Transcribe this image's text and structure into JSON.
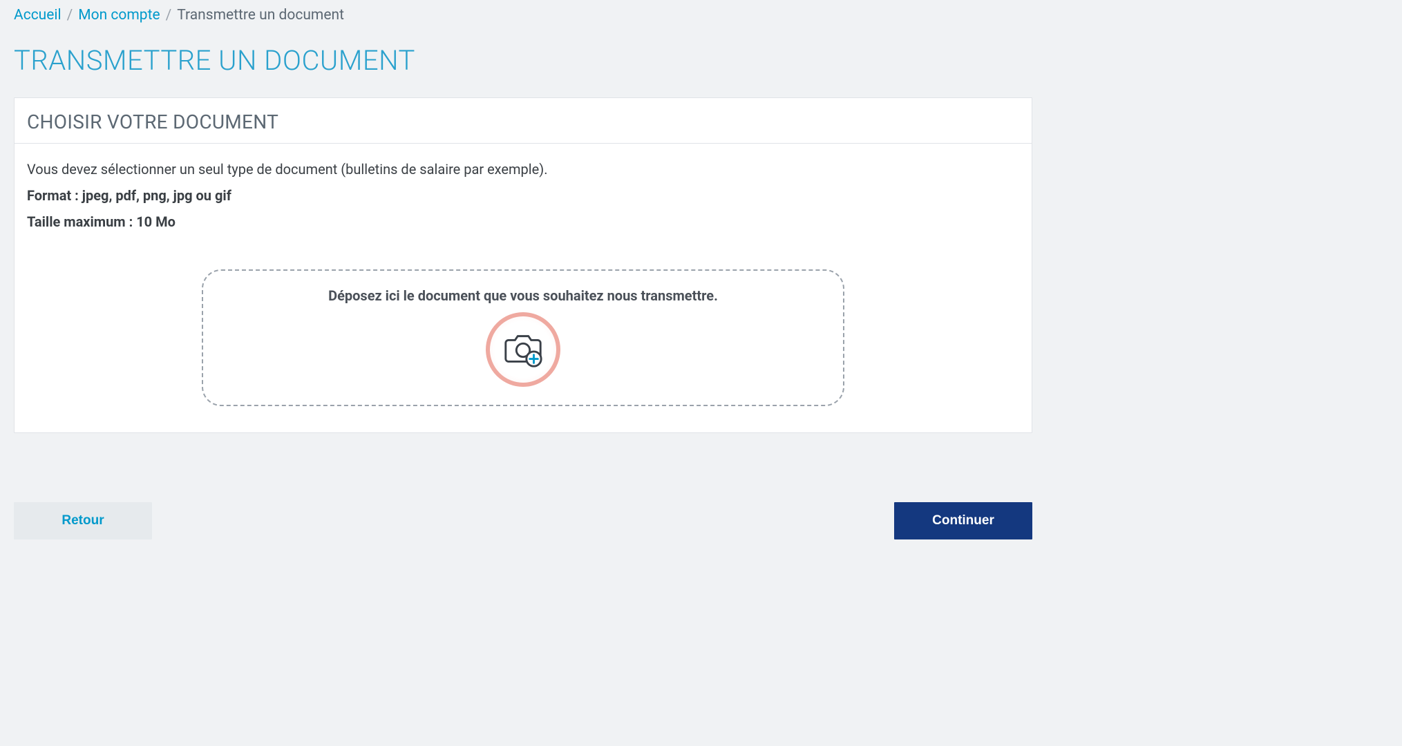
{
  "breadcrumb": {
    "home": "Accueil",
    "account": "Mon compte",
    "current": "Transmettre un document"
  },
  "page_title": "TRANSMETTRE UN DOCUMENT",
  "card": {
    "header": "CHOISIR VOTRE DOCUMENT",
    "instructions": {
      "line1": "Vous devez sélectionner un seul type de document (bulletins de salaire par exemple).",
      "format": "Format : jpeg, pdf, png, jpg ou gif",
      "maxsize": "Taille maximum : 10 Mo"
    },
    "dropzone": {
      "text": "Déposez ici le document que vous souhaitez nous transmettre."
    }
  },
  "buttons": {
    "back": "Retour",
    "continue": "Continuer"
  }
}
